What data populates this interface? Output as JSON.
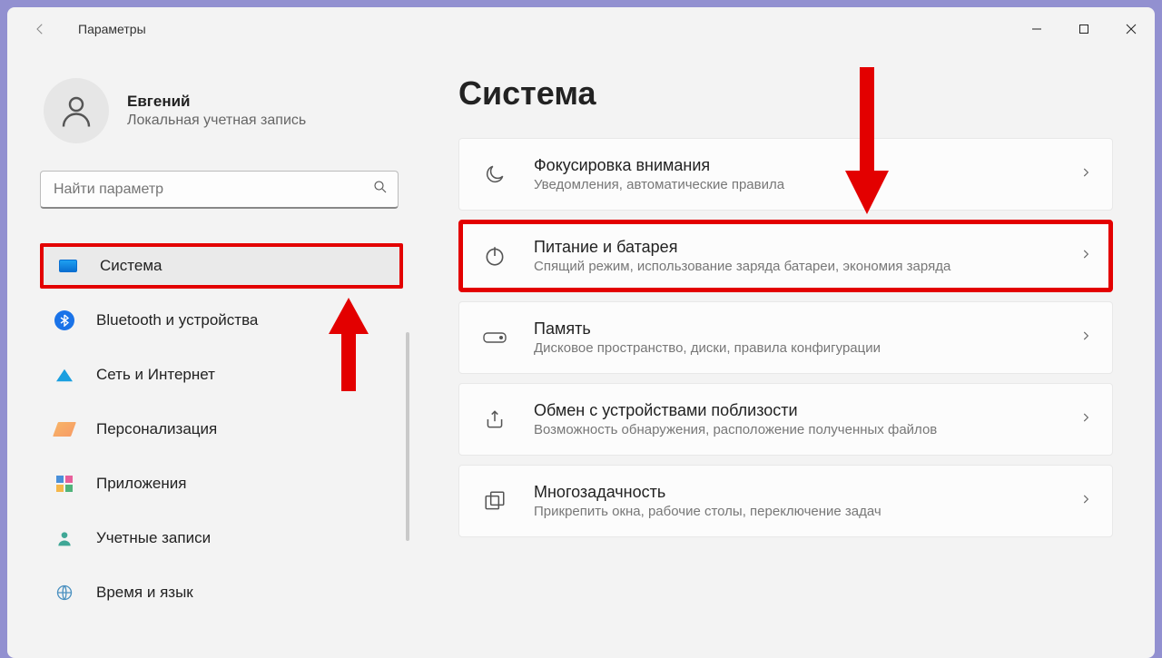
{
  "window": {
    "title": "Параметры"
  },
  "profile": {
    "name": "Евгений",
    "account_type": "Локальная учетная запись"
  },
  "search": {
    "placeholder": "Найти параметр"
  },
  "sidebar": {
    "items": [
      {
        "label": "Система",
        "selected": true,
        "highlighted": true,
        "icon": "system"
      },
      {
        "label": "Bluetooth и устройства",
        "icon": "bluetooth"
      },
      {
        "label": "Сеть и Интернет",
        "icon": "network"
      },
      {
        "label": "Персонализация",
        "icon": "personalization"
      },
      {
        "label": "Приложения",
        "icon": "apps"
      },
      {
        "label": "Учетные записи",
        "icon": "accounts"
      },
      {
        "label": "Время и язык",
        "icon": "time"
      }
    ]
  },
  "main": {
    "heading": "Система",
    "cards": [
      {
        "title": "Фокусировка внимания",
        "subtitle": "Уведомления, автоматические правила",
        "icon": "moon"
      },
      {
        "title": "Питание и батарея",
        "subtitle": "Спящий режим, использование заряда батареи, экономия заряда",
        "icon": "power",
        "highlighted": true
      },
      {
        "title": "Память",
        "subtitle": "Дисковое пространство, диски, правила конфигурации",
        "icon": "storage"
      },
      {
        "title": "Обмен с устройствами поблизости",
        "subtitle": "Возможность обнаружения, расположение полученных файлов",
        "icon": "share"
      },
      {
        "title": "Многозадачность",
        "subtitle": "Прикрепить окна, рабочие столы, переключение задач",
        "icon": "multitask"
      }
    ]
  },
  "annotations": {
    "arrow_down_main": true,
    "arrow_up_sidebar": true
  }
}
